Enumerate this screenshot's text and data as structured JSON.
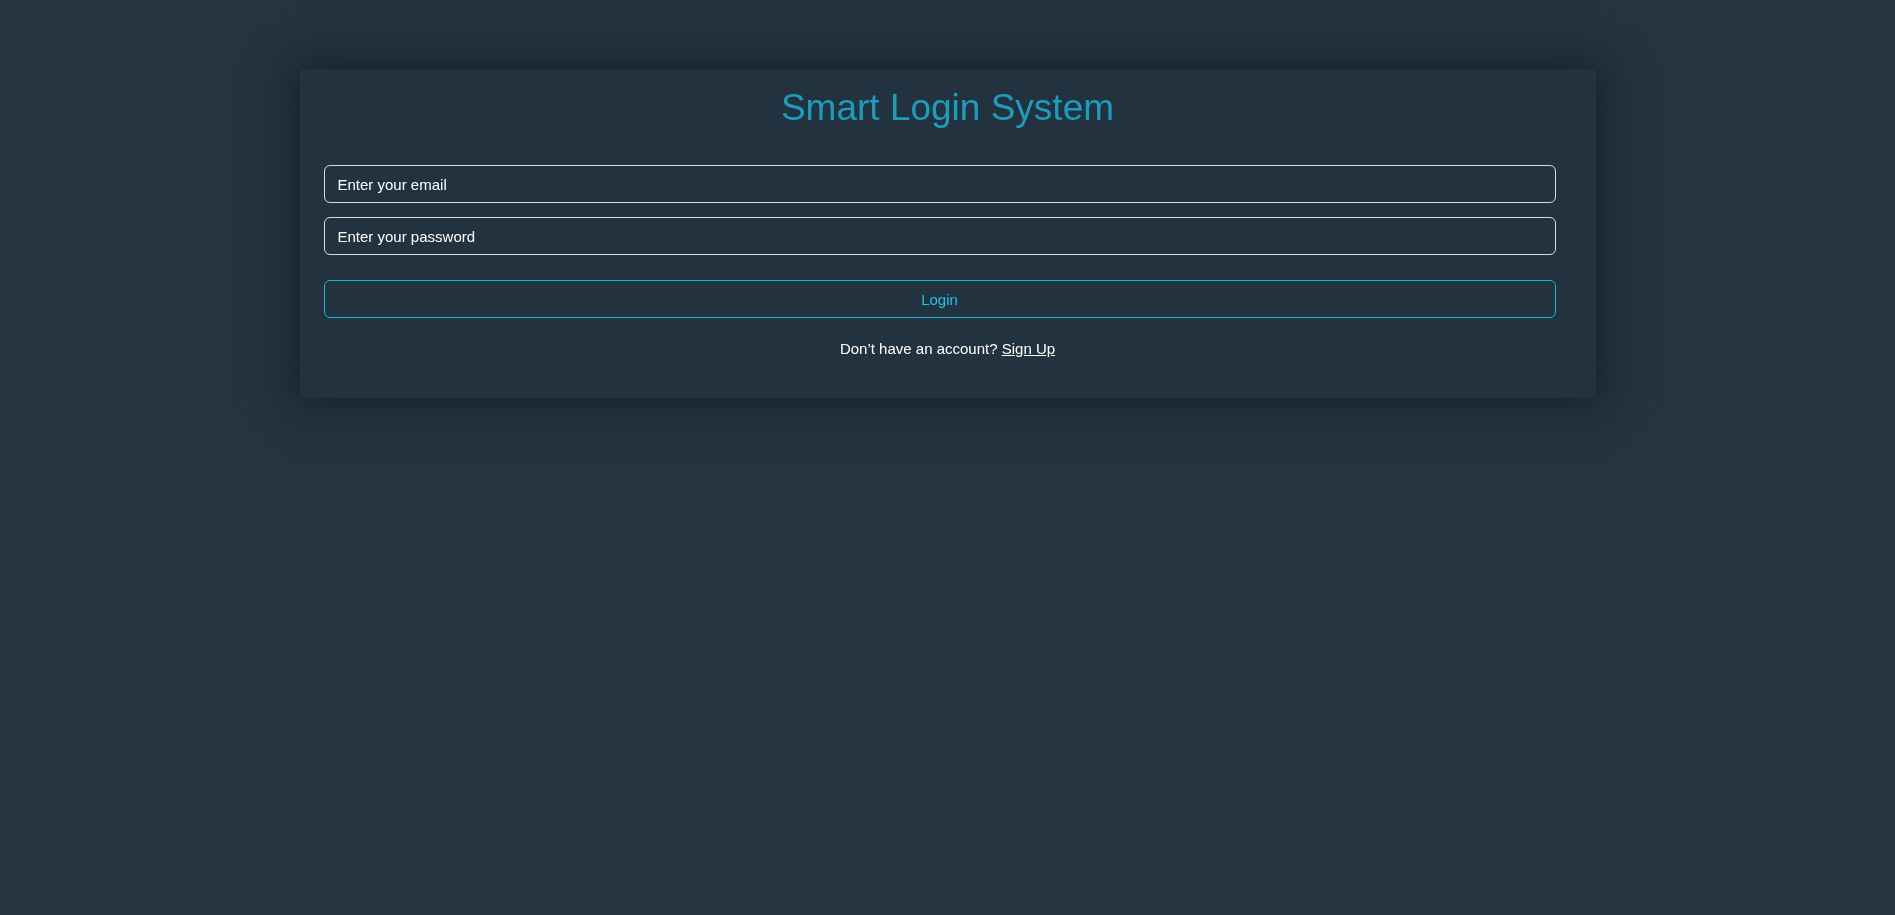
{
  "title": "Smart Login System",
  "fields": [
    {
      "placeholder": "Enter your email"
    },
    {
      "placeholder": "Enter your password"
    }
  ],
  "login_button": {
    "label": "Login"
  },
  "signup_prompt": {
    "text": "Don’t have an account?",
    "link": "Sign Up"
  }
}
